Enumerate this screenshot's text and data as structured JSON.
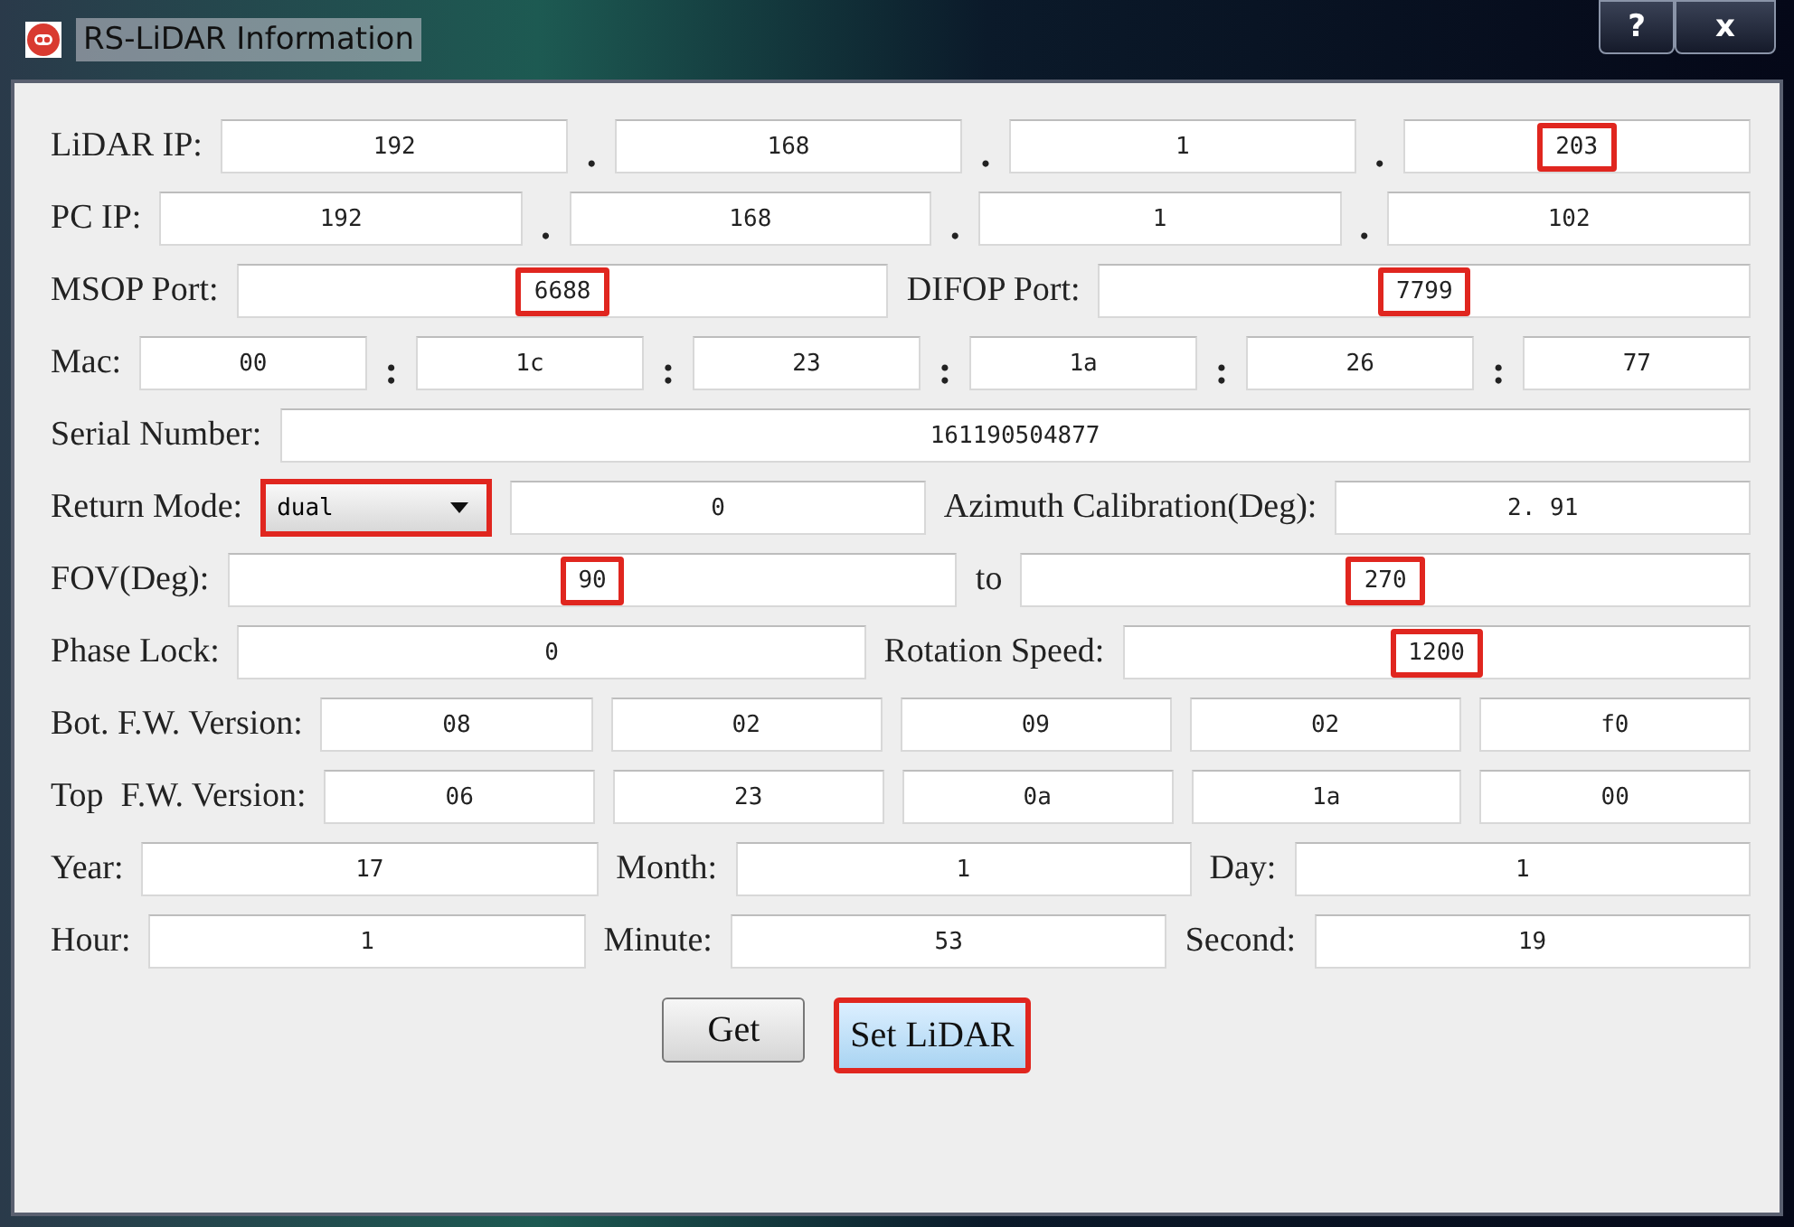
{
  "window": {
    "title": "RS-LiDAR Information",
    "controls": [
      {
        "kind": "help",
        "label": "?"
      },
      {
        "kind": "close",
        "label": "x"
      }
    ]
  },
  "rows": [
    {
      "items": [
        {
          "kind": "label",
          "text": "LiDAR IP:"
        },
        {
          "kind": "field",
          "value": "192",
          "highlighted": false
        },
        {
          "kind": "sep",
          "text": "."
        },
        {
          "kind": "field",
          "value": "168",
          "highlighted": false
        },
        {
          "kind": "sep",
          "text": "."
        },
        {
          "kind": "field",
          "value": "1",
          "highlighted": false
        },
        {
          "kind": "sep",
          "text": "."
        },
        {
          "kind": "field",
          "value": "203",
          "highlighted": true
        }
      ]
    },
    {
      "items": [
        {
          "kind": "label",
          "text": "PC IP:"
        },
        {
          "kind": "field",
          "value": "192",
          "highlighted": false
        },
        {
          "kind": "sep",
          "text": "."
        },
        {
          "kind": "field",
          "value": "168",
          "highlighted": false
        },
        {
          "kind": "sep",
          "text": "."
        },
        {
          "kind": "field",
          "value": "1",
          "highlighted": false
        },
        {
          "kind": "sep",
          "text": "."
        },
        {
          "kind": "field",
          "value": "102",
          "highlighted": false
        }
      ]
    },
    {
      "items": [
        {
          "kind": "label",
          "text": "MSOP Port:"
        },
        {
          "kind": "field",
          "value": "6688",
          "highlighted": true
        },
        {
          "kind": "label",
          "text": "DIFOP Port:"
        },
        {
          "kind": "field",
          "value": "7799",
          "highlighted": true
        }
      ]
    },
    {
      "items": [
        {
          "kind": "label",
          "text": "Mac:"
        },
        {
          "kind": "field",
          "value": "00",
          "highlighted": false
        },
        {
          "kind": "sep",
          "text": ":"
        },
        {
          "kind": "field",
          "value": "1c",
          "highlighted": false
        },
        {
          "kind": "sep",
          "text": ":"
        },
        {
          "kind": "field",
          "value": "23",
          "highlighted": false
        },
        {
          "kind": "sep",
          "text": ":"
        },
        {
          "kind": "field",
          "value": "1a",
          "highlighted": false
        },
        {
          "kind": "sep",
          "text": ":"
        },
        {
          "kind": "field",
          "value": "26",
          "highlighted": false
        },
        {
          "kind": "sep",
          "text": ":"
        },
        {
          "kind": "field",
          "value": "77",
          "highlighted": false
        }
      ]
    },
    {
      "items": [
        {
          "kind": "label",
          "text": "Serial Number:"
        },
        {
          "kind": "field",
          "value": "161190504877",
          "highlighted": false
        }
      ]
    },
    {
      "items": [
        {
          "kind": "label",
          "text": "Return Mode:"
        },
        {
          "kind": "dropdown",
          "value": "dual",
          "highlighted": true
        },
        {
          "kind": "field",
          "value": "0",
          "highlighted": false
        },
        {
          "kind": "label",
          "text": "Azimuth Calibration(Deg):"
        },
        {
          "kind": "field",
          "value": "2. 91",
          "highlighted": false
        }
      ]
    },
    {
      "items": [
        {
          "kind": "label",
          "text": "FOV(Deg):"
        },
        {
          "kind": "field",
          "value": "90",
          "highlighted": true
        },
        {
          "kind": "label",
          "text": "to"
        },
        {
          "kind": "field",
          "value": "270",
          "highlighted": true
        }
      ]
    },
    {
      "items": [
        {
          "kind": "label",
          "text": "Phase Lock:"
        },
        {
          "kind": "field",
          "value": "0",
          "highlighted": false
        },
        {
          "kind": "label",
          "text": "Rotation Speed:"
        },
        {
          "kind": "field",
          "value": "1200",
          "highlighted": true
        }
      ]
    },
    {
      "items": [
        {
          "kind": "label",
          "text": "Bot. F.W. Version:"
        },
        {
          "kind": "field",
          "value": "08",
          "highlighted": false
        },
        {
          "kind": "field",
          "value": "02",
          "highlighted": false
        },
        {
          "kind": "field",
          "value": "09",
          "highlighted": false
        },
        {
          "kind": "field",
          "value": "02",
          "highlighted": false
        },
        {
          "kind": "field",
          "value": "f0",
          "highlighted": false
        }
      ]
    },
    {
      "items": [
        {
          "kind": "label",
          "text": "Top  F.W. Version:"
        },
        {
          "kind": "field",
          "value": "06",
          "highlighted": false
        },
        {
          "kind": "field",
          "value": "23",
          "highlighted": false
        },
        {
          "kind": "field",
          "value": "0a",
          "highlighted": false
        },
        {
          "kind": "field",
          "value": "1a",
          "highlighted": false
        },
        {
          "kind": "field",
          "value": "00",
          "highlighted": false
        }
      ]
    },
    {
      "items": [
        {
          "kind": "label",
          "text": "Year:"
        },
        {
          "kind": "field",
          "value": "17",
          "highlighted": false
        },
        {
          "kind": "label",
          "text": "Month:"
        },
        {
          "kind": "field",
          "value": "1",
          "highlighted": false
        },
        {
          "kind": "label",
          "text": "Day:"
        },
        {
          "kind": "field",
          "value": "1",
          "highlighted": false
        }
      ]
    },
    {
      "items": [
        {
          "kind": "label",
          "text": "Hour:"
        },
        {
          "kind": "field",
          "value": "1",
          "highlighted": false
        },
        {
          "kind": "label",
          "text": "Minute:"
        },
        {
          "kind": "field",
          "value": "53",
          "highlighted": false
        },
        {
          "kind": "label",
          "text": "Second:"
        },
        {
          "kind": "field",
          "value": "19",
          "highlighted": false
        }
      ]
    }
  ],
  "buttons": [
    {
      "label": "Get",
      "highlighted": false
    },
    {
      "label": "Set LiDAR",
      "highlighted": true
    }
  ]
}
